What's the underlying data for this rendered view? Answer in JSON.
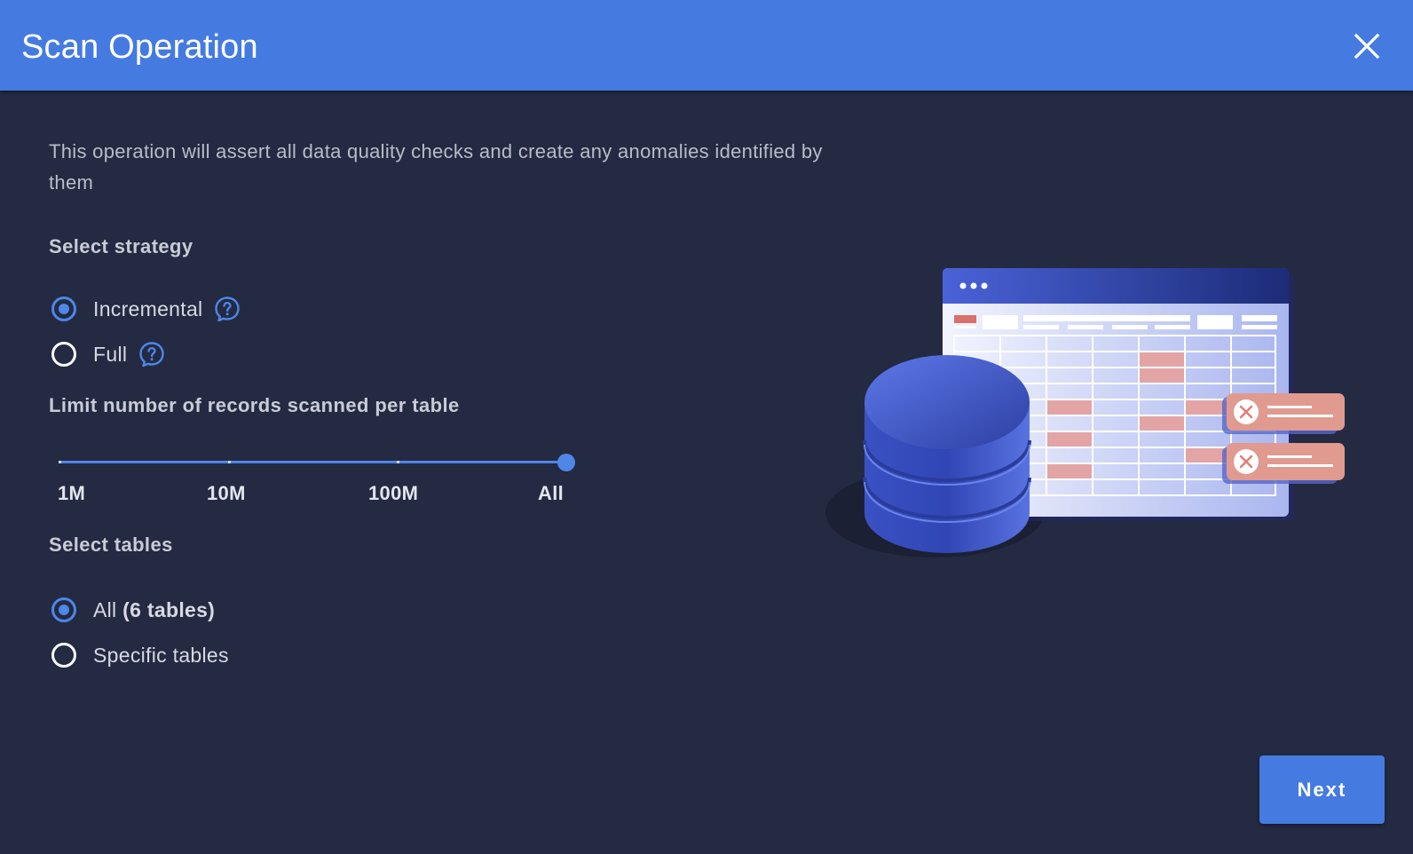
{
  "dialog": {
    "title": "Scan Operation",
    "description": "This operation will assert all data quality checks and create any anomalies identified by them"
  },
  "strategy": {
    "label": "Select strategy",
    "options": [
      {
        "label": "Incremental",
        "selected": true,
        "help_icon": "question-bubble-icon"
      },
      {
        "label": "Full",
        "selected": false,
        "help_icon": "question-bubble-icon"
      }
    ]
  },
  "limit": {
    "label": "Limit number of records scanned per table",
    "marks": [
      "1M",
      "10M",
      "100M",
      "All"
    ],
    "selected": "All"
  },
  "tables": {
    "label": "Select tables",
    "options": [
      {
        "label": "All",
        "count_label": "(6 tables)",
        "selected": true
      },
      {
        "label": "Specific tables",
        "selected": false
      }
    ]
  },
  "footer": {
    "next_label": "Next"
  },
  "colors": {
    "accent": "#457be1",
    "background": "#232a42",
    "anomaly": "#e09a90"
  }
}
